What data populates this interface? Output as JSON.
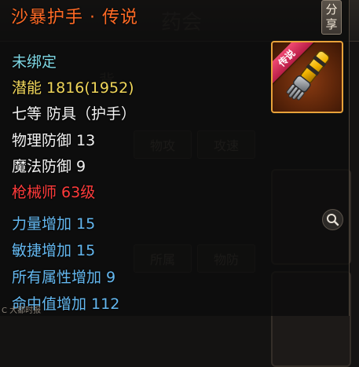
{
  "background": {
    "faint_texts": [
      "药会",
      "背",
      "物攻",
      "攻速",
      "所属",
      "物防"
    ]
  },
  "tooltip": {
    "title": "沙暴护手 · 传说",
    "share_label_line1": "分",
    "share_label_line2": "享",
    "item_badge": "传说",
    "lines": [
      {
        "text": "未绑定",
        "color": "#7fd9e6"
      },
      {
        "text": "潜能 1816(1952)",
        "color": "#f0d65a"
      },
      {
        "text": "七等 防具（护手）",
        "color": "#f2f2f2"
      },
      {
        "text": "物理防御 13",
        "color": "#f2f2f2"
      },
      {
        "text": "魔法防御 9",
        "color": "#f2f2f2"
      },
      {
        "text": "枪械师 63级",
        "color": "#ff3b3b"
      },
      {
        "text": "力量增加 15",
        "color": "#64b8f0"
      },
      {
        "text": "敏捷增加 15",
        "color": "#64b8f0"
      },
      {
        "text": "所有属性增加 9",
        "color": "#64b8f0"
      },
      {
        "text": "命中值增加 112",
        "color": "#64b8f0"
      }
    ],
    "icons": {
      "search": "magnifier-icon",
      "item": "gauntlet-icon"
    }
  },
  "bottom_tag": "C 大都时报"
}
